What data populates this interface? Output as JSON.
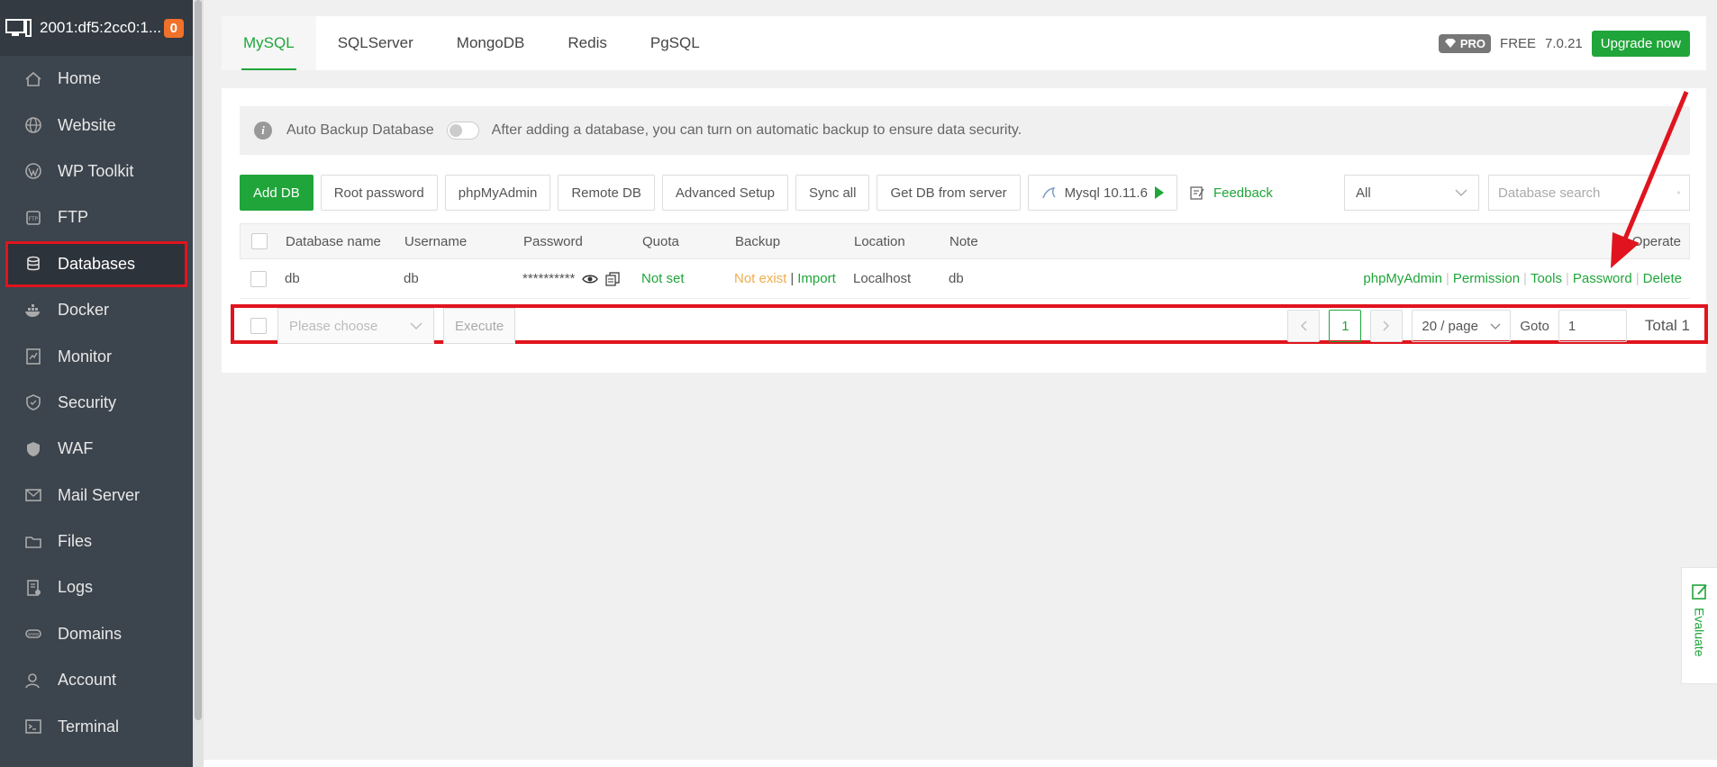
{
  "sidebar": {
    "server_label": "2001:df5:2cc0:1...",
    "badge_count": "0",
    "items": [
      {
        "label": "Home",
        "icon": "home-icon"
      },
      {
        "label": "Website",
        "icon": "globe-icon"
      },
      {
        "label": "WP Toolkit",
        "icon": "wordpress-icon"
      },
      {
        "label": "FTP",
        "icon": "ftp-icon"
      },
      {
        "label": "Databases",
        "icon": "database-icon",
        "active": true
      },
      {
        "label": "Docker",
        "icon": "docker-icon"
      },
      {
        "label": "Monitor",
        "icon": "monitor-icon"
      },
      {
        "label": "Security",
        "icon": "shield-icon"
      },
      {
        "label": "WAF",
        "icon": "waf-icon"
      },
      {
        "label": "Mail Server",
        "icon": "mail-icon"
      },
      {
        "label": "Files",
        "icon": "folder-icon"
      },
      {
        "label": "Logs",
        "icon": "logs-icon"
      },
      {
        "label": "Domains",
        "icon": "domains-icon"
      },
      {
        "label": "Account",
        "icon": "user-icon"
      },
      {
        "label": "Terminal",
        "icon": "terminal-icon"
      }
    ]
  },
  "tabs": [
    {
      "label": "MySQL",
      "active": true
    },
    {
      "label": "SQLServer"
    },
    {
      "label": "MongoDB"
    },
    {
      "label": "Redis"
    },
    {
      "label": "PgSQL"
    }
  ],
  "header_right": {
    "pro_label": "PRO",
    "free_label": "FREE",
    "version": "7.0.21",
    "upgrade_label": "Upgrade now"
  },
  "alert": {
    "title": "Auto Backup Database",
    "message": "After adding a database, you can turn on automatic backup to ensure data security."
  },
  "toolbar": {
    "add_db": "Add DB",
    "root_password": "Root password",
    "phpmyadmin": "phpMyAdmin",
    "remote_db": "Remote DB",
    "advanced_setup": "Advanced Setup",
    "sync_all": "Sync all",
    "get_db": "Get DB from server",
    "mysql_version": "Mysql 10.11.6",
    "feedback": "Feedback",
    "filter_value": "All",
    "search_placeholder": "Database search"
  },
  "table": {
    "headers": [
      "Database name",
      "Username",
      "Password",
      "Quota",
      "Backup",
      "Location",
      "Note",
      "Operate"
    ],
    "rows": [
      {
        "name": "db",
        "username": "db",
        "password": "**********",
        "quota": "Not set",
        "backup_status": "Not exist",
        "backup_import": "Import",
        "location": "Localhost",
        "note": "db",
        "ops": [
          "phpMyAdmin",
          "Permission",
          "Tools",
          "Password",
          "Delete"
        ]
      }
    ]
  },
  "footer": {
    "choose_placeholder": "Please choose",
    "execute": "Execute",
    "page": "1",
    "page_size": "20 / page",
    "goto_label": "Goto",
    "goto_value": "1",
    "total": "Total 1"
  },
  "evaluate_label": "Evaluate",
  "colors": {
    "accent": "#20a53a",
    "sidebar_bg": "#3c444d",
    "highlight": "#e0141e",
    "badge": "#f0712a",
    "warning": "#f0ad4e"
  }
}
